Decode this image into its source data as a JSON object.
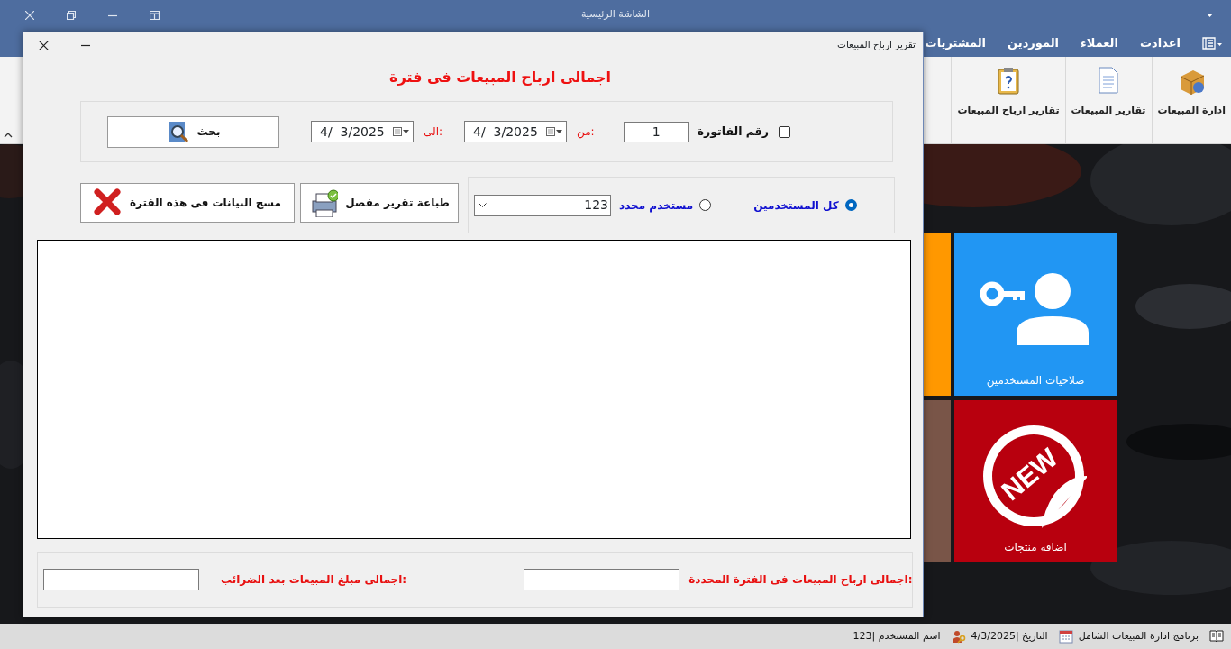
{
  "window": {
    "title": "الشاشة الرئيسية"
  },
  "ribbon": {
    "tabs": [
      {
        "label": "اعدادت"
      },
      {
        "label": "العملاء"
      },
      {
        "label": "الموردين"
      },
      {
        "label": "المشتريات"
      }
    ],
    "groups": [
      {
        "kind": "box",
        "label": "ادارة المبيعات"
      },
      {
        "kind": "document",
        "label": "تقارير المبيعات"
      },
      {
        "kind": "clipboard",
        "label": "تقارير ارباح المبيعات"
      }
    ]
  },
  "tiles": [
    {
      "kind": "users",
      "label": "صلاحيات المستخدمين",
      "color": "#2196f3"
    },
    {
      "kind": "plain",
      "color": "#ff9800"
    },
    {
      "kind": "new",
      "label": "اضافه منتجات",
      "badge_text": "NEW",
      "color": "#b8000e"
    },
    {
      "kind": "plain",
      "color": "#795548"
    }
  ],
  "status_bar": [
    {
      "kind": "book",
      "text": "برنامج ادارة المبيعات الشامل"
    },
    {
      "kind": "calendar",
      "text": "التاريخ |4/3/2025"
    },
    {
      "kind": "user",
      "text": "اسم المستخدم |123"
    }
  ],
  "dialog": {
    "title": "تقرير ارباح المبيعات",
    "heading": "اجمالى ارباح المبيعات فى فترة",
    "invoice": {
      "checked": false,
      "label": "رقم الفاتورة",
      "value": "1"
    },
    "from": {
      "label": "من:",
      "value": "4/  3/2025"
    },
    "to": {
      "label": "الى:",
      "value": "4/  3/2025"
    },
    "search_button": "بحث",
    "users": [
      {
        "label": "كل المستخدمين",
        "selected": true
      },
      {
        "label": "مستخدم محدد",
        "selected": false
      }
    ],
    "user_combo": "123",
    "actions": [
      {
        "kind": "print",
        "label": "طباعة تقرير مفصل"
      },
      {
        "kind": "clear",
        "label": "مسح البيانات فى هذه الفترة"
      }
    ],
    "totals": [
      {
        "label": "اجمالى ارباح المبيعات فى الفترة المحددة:"
      },
      {
        "label": "اجمالى مبلغ المبيعات بعد الضرائب:"
      }
    ]
  }
}
